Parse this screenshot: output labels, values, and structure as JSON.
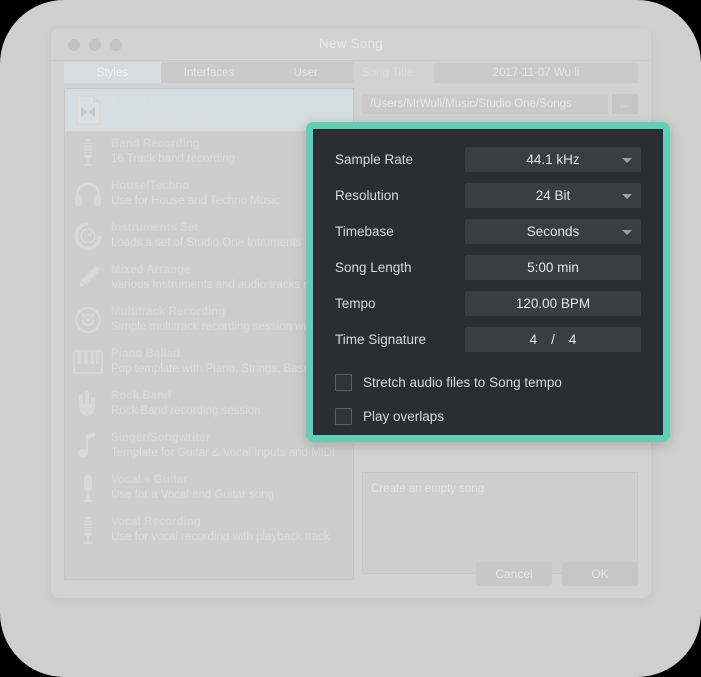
{
  "window": {
    "title": "New Song",
    "traffic_lights": [
      "close",
      "minimize",
      "zoom"
    ]
  },
  "tabs": [
    {
      "label": "Styles",
      "active": true
    },
    {
      "label": "Interfaces",
      "active": false
    },
    {
      "label": "User",
      "active": false
    }
  ],
  "templates": [
    {
      "title": "Empty Song",
      "desc": "Create an empty song",
      "icon": "document-icon",
      "selected": true
    },
    {
      "title": "Band Recording",
      "desc": "16 Track band recording",
      "icon": "microphone-rack-icon",
      "selected": false
    },
    {
      "title": "House/Techno",
      "desc": "Use for House and Techno Music",
      "icon": "headphones-icon",
      "selected": false
    },
    {
      "title": "Instruments Set",
      "desc": "Loads a set of  Studio One Intruments r",
      "icon": "knob-icon",
      "selected": false
    },
    {
      "title": "Mixed Arrange",
      "desc": "Various Instruments and audio tracks r",
      "icon": "pencil-icon",
      "selected": false
    },
    {
      "title": "Multitrack Recording",
      "desc": "Simple multitrack recording session wi",
      "icon": "disc-icon",
      "selected": false
    },
    {
      "title": "Piano Ballad",
      "desc": "Pop template with Piano, Strings, Bass",
      "icon": "piano-keys-icon",
      "selected": false
    },
    {
      "title": "Rock Band",
      "desc": "Rock Band recording session",
      "icon": "rock-hand-icon",
      "selected": false
    },
    {
      "title": "Singer/Songwriter",
      "desc": "Template for Guitar & Vocal Inputs and MIDI",
      "icon": "music-note-icon",
      "selected": false
    },
    {
      "title": "Vocal + Guitar",
      "desc": "Use for a Vocal and Guitar song",
      "icon": "mic-icon",
      "selected": false
    },
    {
      "title": "Vocal Recording",
      "desc": "Use for vocal recording with playback track",
      "icon": "microphone-rack-icon",
      "selected": false
    }
  ],
  "details": {
    "song_title_label": "Song Title",
    "song_title_value": "2017-11-07 Wu li",
    "path_value": "/Users/MrWuli/Music/Studio One/Songs",
    "path_browse_label": "...",
    "description": "Create an empty song"
  },
  "buttons": {
    "cancel": "Cancel",
    "ok": "OK"
  },
  "settings": {
    "rows": [
      {
        "label": "Sample Rate",
        "value": "44.1 kHz",
        "type": "dropdown"
      },
      {
        "label": "Resolution",
        "value": "24 Bit",
        "type": "dropdown"
      },
      {
        "label": "Timebase",
        "value": "Seconds",
        "type": "dropdown"
      },
      {
        "label": "Song Length",
        "value": "5:00 min",
        "type": "text"
      },
      {
        "label": "Tempo",
        "value": "120.00 BPM",
        "type": "text"
      }
    ],
    "time_signature": {
      "label": "Time Signature",
      "numerator": "4",
      "separator": "/",
      "denominator": "4"
    },
    "checkboxes": [
      {
        "label": "Stretch audio files to Song tempo",
        "checked": false
      },
      {
        "label": "Play overlaps",
        "checked": false
      }
    ]
  },
  "colors": {
    "highlight_border": "#62cfb4",
    "panel_background": "#2b2d32",
    "field_background": "#3a3d43",
    "window_background": "#d2d2d2",
    "selected_row": "#d3dde2"
  }
}
